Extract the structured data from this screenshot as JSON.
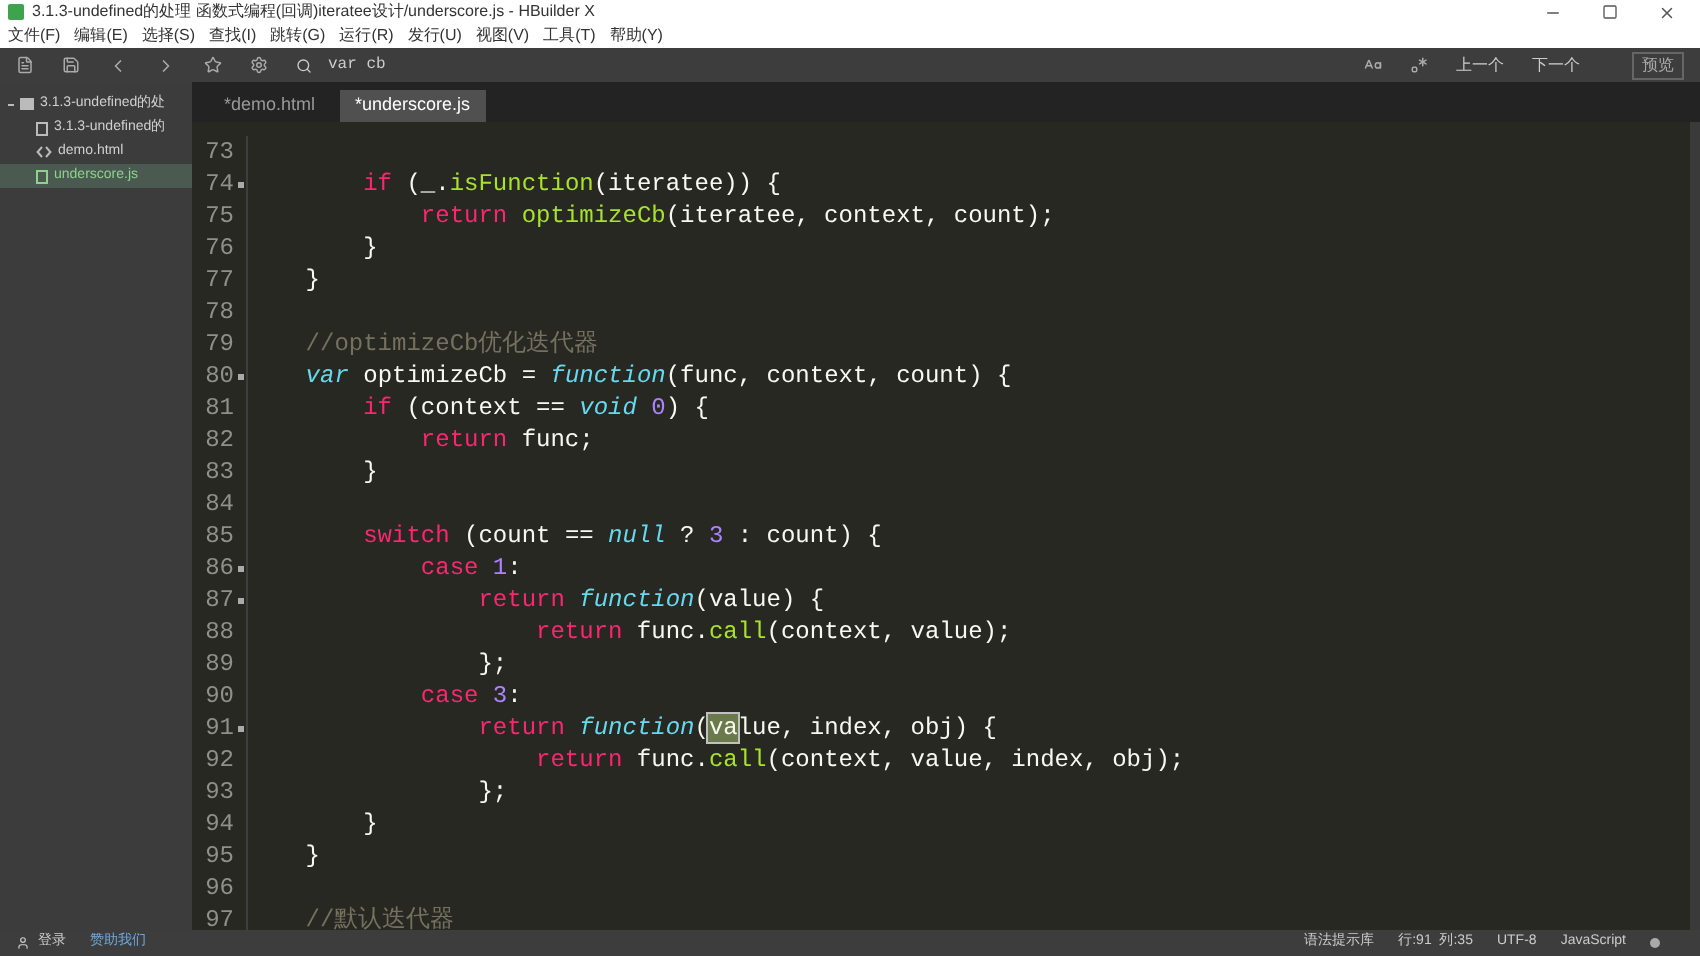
{
  "window": {
    "title": "3.1.3-undefined的处理 函数式编程(回调)iteratee设计/underscore.js - HBuilder X"
  },
  "menu": [
    "文件(F)",
    "编辑(E)",
    "选择(S)",
    "查找(I)",
    "跳转(G)",
    "运行(R)",
    "发行(U)",
    "视图(V)",
    "工具(T)",
    "帮助(Y)"
  ],
  "toolbar": {
    "search_value": "var cb",
    "buttons": [
      "上一个",
      "下一个",
      "预览"
    ]
  },
  "sidebar": {
    "items": [
      {
        "label": "3.1.3-undefined的处",
        "kind": "folder",
        "selected": false,
        "children": [
          {
            "label": "3.1.3-undefined的",
            "kind": "file",
            "selected": false
          },
          {
            "label": "demo.html",
            "kind": "html",
            "selected": false
          },
          {
            "label": "underscore.js",
            "kind": "js",
            "selected": true
          }
        ]
      }
    ]
  },
  "tabs": [
    {
      "label": "*demo.html",
      "selected": false
    },
    {
      "label": "*underscore.js",
      "selected": true
    }
  ],
  "editor": {
    "lines": [
      {
        "n": "73",
        "fold": false
      },
      {
        "n": "74",
        "fold": true,
        "tokens": [
          {
            "t": "        if",
            "kind": "keyword"
          },
          {
            "t": " (_.",
            "kind": "plain"
          },
          {
            "t": "isFunction",
            "kind": "function"
          },
          {
            "t": "(iteratee)) {",
            "kind": "plain"
          }
        ]
      },
      {
        "n": "75",
        "fold": false,
        "tokens": [
          {
            "t": "            return ",
            "kind": "keyword"
          },
          {
            "t": "optimizeCb",
            "kind": "function"
          },
          {
            "t": "(iteratee, context, count);",
            "kind": "plain"
          }
        ]
      },
      {
        "n": "76",
        "fold": false,
        "tokens": [
          {
            "t": "        }",
            "kind": "plain"
          }
        ]
      },
      {
        "n": "77",
        "fold": false,
        "tokens": [
          {
            "t": "    }",
            "kind": "plain"
          }
        ]
      },
      {
        "n": "78",
        "fold": false
      },
      {
        "n": "79",
        "fold": false,
        "tokens": [
          {
            "t": "    //optimizeCb优化迭代器",
            "kind": "comment"
          }
        ]
      },
      {
        "n": "80",
        "fold": true,
        "tokens": [
          {
            "t": "    var",
            "kind": "storage"
          },
          {
            "t": " optimizeCb = ",
            "kind": "plain"
          },
          {
            "t": "function",
            "kind": "storage"
          },
          {
            "t": "(func, context, count) {",
            "kind": "plain"
          }
        ]
      },
      {
        "n": "81",
        "fold": false,
        "tokens": [
          {
            "t": "        if",
            "kind": "keyword"
          },
          {
            "t": " (context == ",
            "kind": "plain"
          },
          {
            "t": "void ",
            "kind": "storage"
          },
          {
            "t": "0",
            "kind": "number"
          },
          {
            "t": ") {",
            "kind": "plain"
          }
        ]
      },
      {
        "n": "82",
        "fold": false,
        "tokens": [
          {
            "t": "            return",
            "kind": "keyword"
          },
          {
            "t": " func;",
            "kind": "plain"
          }
        ]
      },
      {
        "n": "83",
        "fold": false,
        "tokens": [
          {
            "t": "        }",
            "kind": "plain"
          }
        ]
      },
      {
        "n": "84",
        "fold": false
      },
      {
        "n": "85",
        "fold": false,
        "tokens": [
          {
            "t": "        switch",
            "kind": "keyword"
          },
          {
            "t": " (count == ",
            "kind": "plain"
          },
          {
            "t": "null",
            "kind": "storage"
          },
          {
            "t": " ? ",
            "kind": "plain"
          },
          {
            "t": "3",
            "kind": "number"
          },
          {
            "t": " : count) {",
            "kind": "plain"
          }
        ]
      },
      {
        "n": "86",
        "fold": true,
        "tokens": [
          {
            "t": "            case ",
            "kind": "keyword"
          },
          {
            "t": "1",
            "kind": "number"
          },
          {
            "t": ":",
            "kind": "plain"
          }
        ]
      },
      {
        "n": "87",
        "fold": true,
        "tokens": [
          {
            "t": "                return ",
            "kind": "keyword"
          },
          {
            "t": "function",
            "kind": "storage"
          },
          {
            "t": "(value) {",
            "kind": "plain"
          }
        ]
      },
      {
        "n": "88",
        "fold": false,
        "tokens": [
          {
            "t": "                    return",
            "kind": "keyword"
          },
          {
            "t": " func.",
            "kind": "plain"
          },
          {
            "t": "call",
            "kind": "function"
          },
          {
            "t": "(context, value);",
            "kind": "plain"
          }
        ]
      },
      {
        "n": "89",
        "fold": false,
        "tokens": [
          {
            "t": "                };",
            "kind": "plain"
          }
        ]
      },
      {
        "n": "90",
        "fold": false,
        "tokens": [
          {
            "t": "            case ",
            "kind": "keyword"
          },
          {
            "t": "3",
            "kind": "number"
          },
          {
            "t": ":",
            "kind": "plain"
          }
        ]
      },
      {
        "n": "91",
        "fold": true,
        "tokens": [
          {
            "t": "                return ",
            "kind": "keyword"
          },
          {
            "t": "function",
            "kind": "storage"
          },
          {
            "t": "(",
            "kind": "plain"
          },
          {
            "t": "va",
            "kind": "match"
          },
          {
            "t": "lue, index, obj) {",
            "kind": "plain"
          }
        ]
      },
      {
        "n": "92",
        "fold": false,
        "tokens": [
          {
            "t": "                    return",
            "kind": "keyword"
          },
          {
            "t": " func.",
            "kind": "plain"
          },
          {
            "t": "call",
            "kind": "function"
          },
          {
            "t": "(context, value, index, obj);",
            "kind": "plain"
          }
        ]
      },
      {
        "n": "93",
        "fold": false,
        "tokens": [
          {
            "t": "                };",
            "kind": "plain"
          }
        ]
      },
      {
        "n": "94",
        "fold": false,
        "tokens": [
          {
            "t": "        }",
            "kind": "plain"
          }
        ]
      },
      {
        "n": "95",
        "fold": false,
        "tokens": [
          {
            "t": "    }",
            "kind": "plain"
          }
        ]
      },
      {
        "n": "96",
        "fold": false
      },
      {
        "n": "97",
        "fold": false,
        "tokens": [
          {
            "t": "    //默认迭代器",
            "kind": "comment"
          }
        ]
      }
    ]
  },
  "status_bar": {
    "login": "登录",
    "sponsor": "赞助我们",
    "items": [
      "语法提示库",
      "行:91  列:35",
      "UTF-8",
      "JavaScript"
    ]
  }
}
